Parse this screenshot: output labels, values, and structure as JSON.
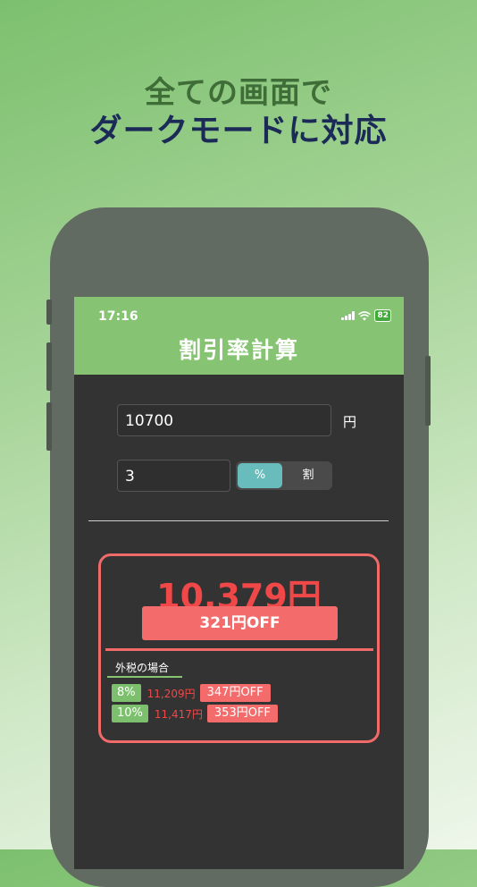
{
  "headline": {
    "line1": "全ての画面で",
    "line2": "ダークモードに対応"
  },
  "status_bar": {
    "time": "17:16",
    "battery": "82"
  },
  "nav": {
    "title": "割引率計算"
  },
  "form": {
    "price_value": "10700",
    "price_unit": "円",
    "discount_value": "3",
    "segment": {
      "options": [
        "%",
        "割"
      ],
      "selected": "%"
    }
  },
  "result": {
    "final_price": "10,379円",
    "discount_label": "321円OFF",
    "tax_section_label": "外税の場合",
    "tax_rows": [
      {
        "rate": "8%",
        "amount": "11,209円",
        "off": "347円OFF"
      },
      {
        "rate": "10%",
        "amount": "11,417円",
        "off": "353円OFF"
      }
    ]
  },
  "colors": {
    "nav_green": "#86c474",
    "accent_red": "#f04848",
    "segment_selected": "#69bcbc",
    "screen_dark": "#333333"
  }
}
